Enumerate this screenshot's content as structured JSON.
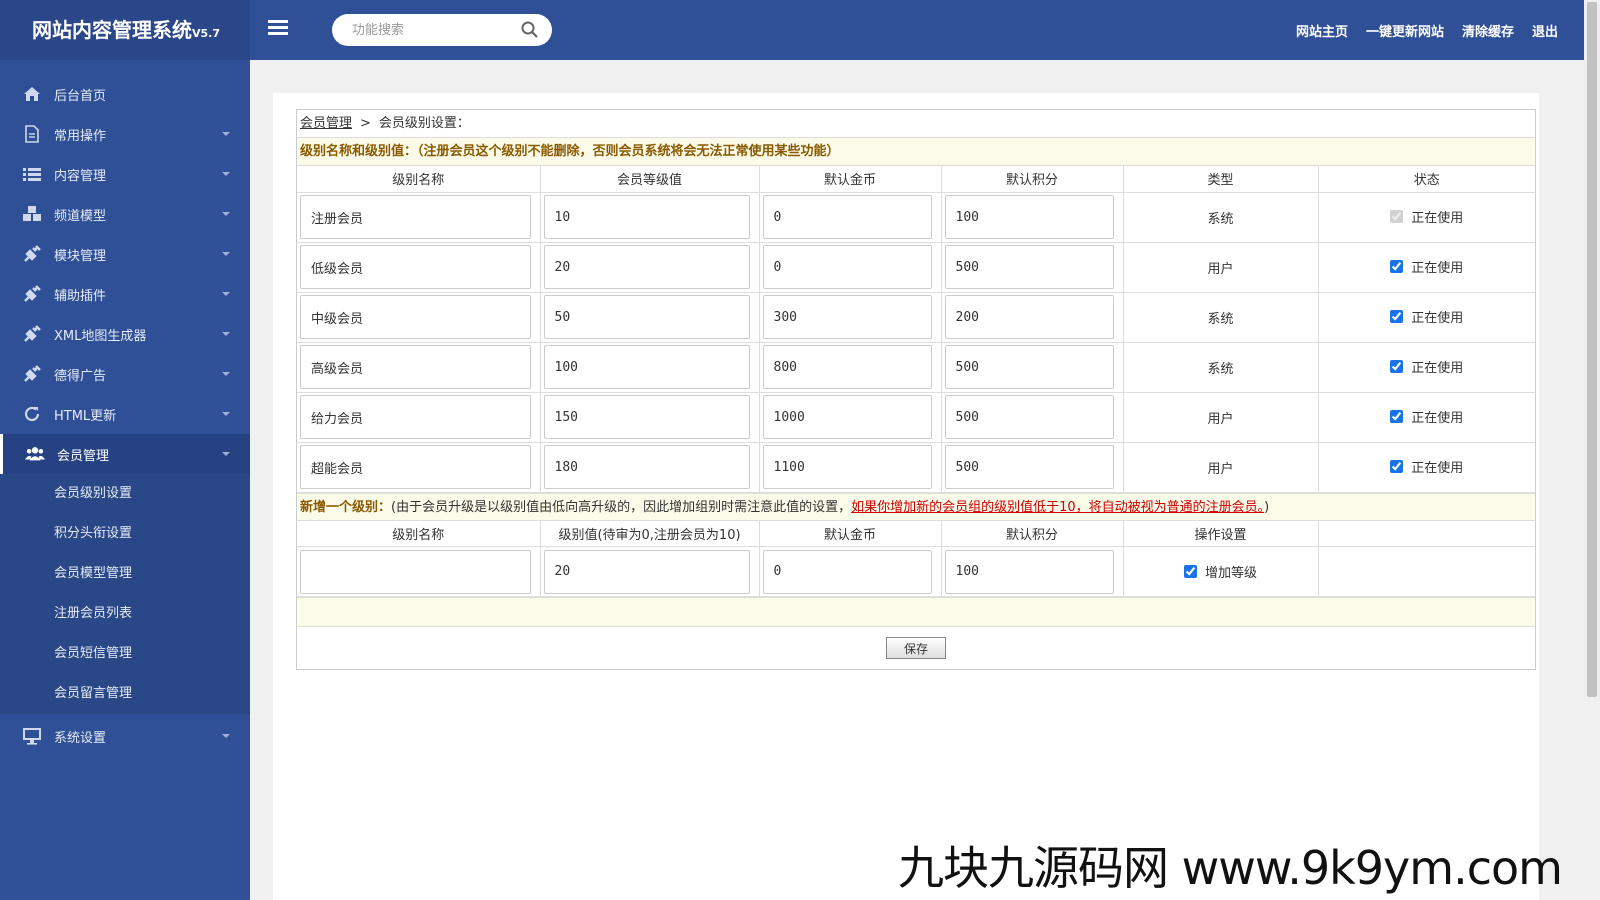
{
  "app": {
    "title": "网站内容管理系统",
    "version": "V5.7"
  },
  "search": {
    "placeholder": "功能搜索"
  },
  "top_links": [
    "网站主页",
    "一键更新网站",
    "清除缓存",
    "退出"
  ],
  "sidebar": {
    "items": [
      {
        "label": "后台首页",
        "icon": "home-icon"
      },
      {
        "label": "常用操作",
        "icon": "document-icon"
      },
      {
        "label": "内容管理",
        "icon": "list-icon"
      },
      {
        "label": "频道模型",
        "icon": "cubes-icon"
      },
      {
        "label": "模块管理",
        "icon": "plug-icon"
      },
      {
        "label": "辅助插件",
        "icon": "plug-icon"
      },
      {
        "label": "XML地图生成器",
        "icon": "plug-icon"
      },
      {
        "label": "德得广告",
        "icon": "plug-icon"
      },
      {
        "label": "HTML更新",
        "icon": "refresh-icon"
      },
      {
        "label": "会员管理",
        "icon": "users-icon"
      }
    ],
    "sub_items": [
      "会员级别设置",
      "积分头衔设置",
      "会员模型管理",
      "注册会员列表",
      "会员短信管理",
      "会员留言管理"
    ],
    "last_item": {
      "label": "系统设置",
      "icon": "monitor-icon"
    }
  },
  "breadcrumb": {
    "parent": "会员管理",
    "separator": ">",
    "current": "会员级别设置："
  },
  "notice": "级别名称和级别值：（注册会员这个级别不能删除，否则会员系统将会无法正常使用某些功能）",
  "levels_table": {
    "headers": [
      "级别名称",
      "会员等级值",
      "默认金币",
      "默认积分",
      "类型",
      "状态"
    ],
    "rows": [
      {
        "name": "注册会员",
        "rank": "10",
        "money": "0",
        "score": "100",
        "type": "系统",
        "status": "正在使用",
        "checked": true,
        "disabled": true
      },
      {
        "name": "低级会员",
        "rank": "20",
        "money": "0",
        "score": "500",
        "type": "用户",
        "status": "正在使用",
        "checked": true,
        "disabled": false
      },
      {
        "name": "中级会员",
        "rank": "50",
        "money": "300",
        "score": "200",
        "type": "系统",
        "status": "正在使用",
        "checked": true,
        "disabled": false
      },
      {
        "name": "高级会员",
        "rank": "100",
        "money": "800",
        "score": "500",
        "type": "系统",
        "status": "正在使用",
        "checked": true,
        "disabled": false
      },
      {
        "name": "给力会员",
        "rank": "150",
        "money": "1000",
        "score": "500",
        "type": "用户",
        "status": "正在使用",
        "checked": true,
        "disabled": false
      },
      {
        "name": "超能会员",
        "rank": "180",
        "money": "1100",
        "score": "500",
        "type": "用户",
        "status": "正在使用",
        "checked": true,
        "disabled": false
      }
    ]
  },
  "add_notice": {
    "label": "新增一个级别：",
    "text": "(由于会员升级是以级别值由低向高升级的，因此增加组别时需注意此值的设置，",
    "warning": "如果你增加新的会员组的级别值低于10，将自动被视为普通的注册会员。",
    "close": ")"
  },
  "add_table": {
    "headers": [
      "级别名称",
      "级别值(待审为0,注册会员为10)",
      "默认金币",
      "默认积分",
      "操作设置",
      ""
    ],
    "row": {
      "name": "",
      "rank": "20",
      "money": "0",
      "score": "100",
      "action": "增加等级",
      "checked": true
    }
  },
  "save_label": "保存",
  "watermark": "九块九源码网 www.9k9ym.com"
}
